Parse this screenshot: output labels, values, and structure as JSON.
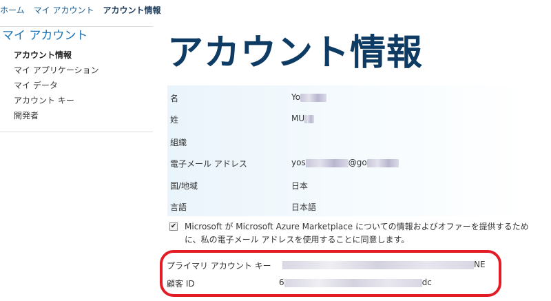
{
  "breadcrumb": [
    "ホーム",
    "マイ アカウント",
    "アカウント情報"
  ],
  "sidebar": {
    "title": "マイ アカウント",
    "items": [
      "アカウント情報",
      "マイ アプリケーション",
      "マイ データ",
      "アカウント キー",
      "開発者"
    ],
    "active_index": 0
  },
  "page": {
    "title": "アカウント情報"
  },
  "account": {
    "rows": [
      {
        "label": "名",
        "value_prefix": "Yo",
        "value_suffix": ""
      },
      {
        "label": "姓",
        "value_prefix": "MU",
        "value_suffix": ""
      },
      {
        "label": "組織",
        "value_prefix": "",
        "value_suffix": ""
      },
      {
        "label": "電子メール アドレス",
        "value_prefix": "yos",
        "value_suffix": "@go"
      },
      {
        "label": "国/地域",
        "value_prefix": "日本",
        "value_suffix": ""
      },
      {
        "label": "言語",
        "value_prefix": "日本語",
        "value_suffix": ""
      }
    ]
  },
  "consent": {
    "checked": true,
    "check_glyph": "✔",
    "text": "Microsoft が Microsoft Azure Marketplace についての情報およびオファーを提供するために、私の電子メール アドレスを使用することに同意します。"
  },
  "keys": {
    "primary_label": "プライマリ アカウント キー",
    "primary_suffix": "NE",
    "customer_label": "顧客 ID",
    "customer_prefix": "6",
    "customer_suffix": "dc"
  },
  "colors": {
    "highlight": "#e21b24",
    "title": "#0d3b63",
    "link": "#1b72b4"
  }
}
